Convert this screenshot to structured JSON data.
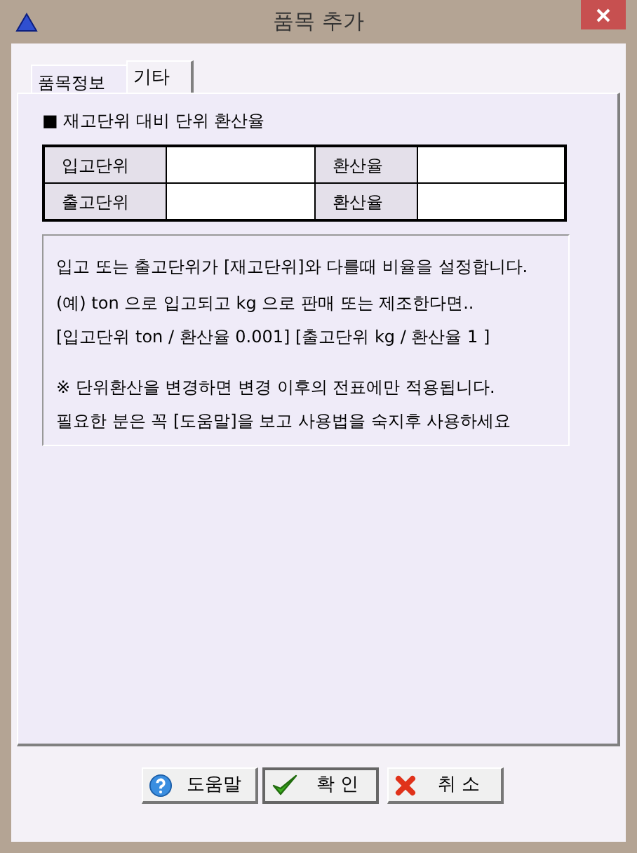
{
  "window": {
    "title": "품목 추가"
  },
  "tabs": [
    {
      "label": "품목정보",
      "selected": false
    },
    {
      "label": "기타",
      "selected": true
    }
  ],
  "section": {
    "title": "■ 재고단위 대비 단위 환산율"
  },
  "conversion_table": {
    "rows": [
      {
        "unit_label": "입고단위",
        "unit_value": "",
        "rate_label": "환산율",
        "rate_value": ""
      },
      {
        "unit_label": "출고단위",
        "unit_value": "",
        "rate_label": "환산율",
        "rate_value": ""
      }
    ]
  },
  "notes": [
    {
      "lines": [
        "입고 또는 출고단위가 [재고단위]와 다를때 비율을 설정합니다."
      ]
    },
    {
      "lines": [
        "(예) ton 으로 입고되고 kg 으로 판매 또는 제조한다면..",
        "[입고단위 ton / 환산율 0.001] [출고단위 kg / 환산율 1 ]"
      ]
    },
    {
      "lines": [
        "※ 단위환산을 변경하면 변경 이후의 전표에만 적용됩니다.",
        "필요한 분은 꼭 [도움말]을 보고 사용법을 숙지후 사용하세요"
      ]
    }
  ],
  "buttons": [
    {
      "kind": "help",
      "label": "도움말",
      "selected": false
    },
    {
      "kind": "ok",
      "label": "확 인",
      "selected": true
    },
    {
      "kind": "cancel",
      "label": "취 소",
      "selected": false
    }
  ]
}
